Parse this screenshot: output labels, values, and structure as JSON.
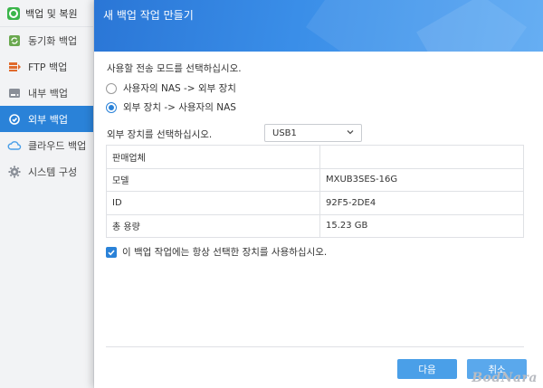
{
  "sidebar": {
    "app_title": "백업 및 복원",
    "items": [
      {
        "label": "동기화 백업",
        "icon": "sync-icon",
        "color": "#6aa84f"
      },
      {
        "label": "FTP 백업",
        "icon": "ftp-icon",
        "color": "#e06b2d"
      },
      {
        "label": "내부 백업",
        "icon": "drive-icon",
        "color": "#8a8f98"
      },
      {
        "label": "외부 백업",
        "icon": "external-backup-icon",
        "color": "#ffffff",
        "active": true
      },
      {
        "label": "클라우드 백업",
        "icon": "cloud-icon",
        "color": "#4a9fe8"
      },
      {
        "label": "시스템 구성",
        "icon": "gear-icon",
        "color": "#8a8f98"
      }
    ]
  },
  "dialog": {
    "title": "새 백업 작업 만들기",
    "instruction": "사용할 전송 모드를 선택하십시오.",
    "modes": [
      {
        "label": "사용자의 NAS -> 외부 장치",
        "checked": false
      },
      {
        "label": "외부 장치 -> 사용자의 NAS",
        "checked": true
      }
    ],
    "device_label": "외부 장치를 선택하십시오.",
    "device_selected": "USB1",
    "info_rows": [
      {
        "key": "판매업체",
        "value": ""
      },
      {
        "key": "모델",
        "value": "MXUB3SES-16G"
      },
      {
        "key": "ID",
        "value": "92F5-2DE4"
      },
      {
        "key": "총 용량",
        "value": "15.23 GB"
      }
    ],
    "always_use_label": "이 백업 작업에는 항상 선택한 장치를 사용하십시오.",
    "always_use_checked": true,
    "next_label": "다음",
    "cancel_label": "취소"
  },
  "watermark": "BodNara",
  "colors": {
    "accent": "#2a82d8",
    "header_start": "#2a76d6",
    "header_end": "#55a5f2"
  }
}
